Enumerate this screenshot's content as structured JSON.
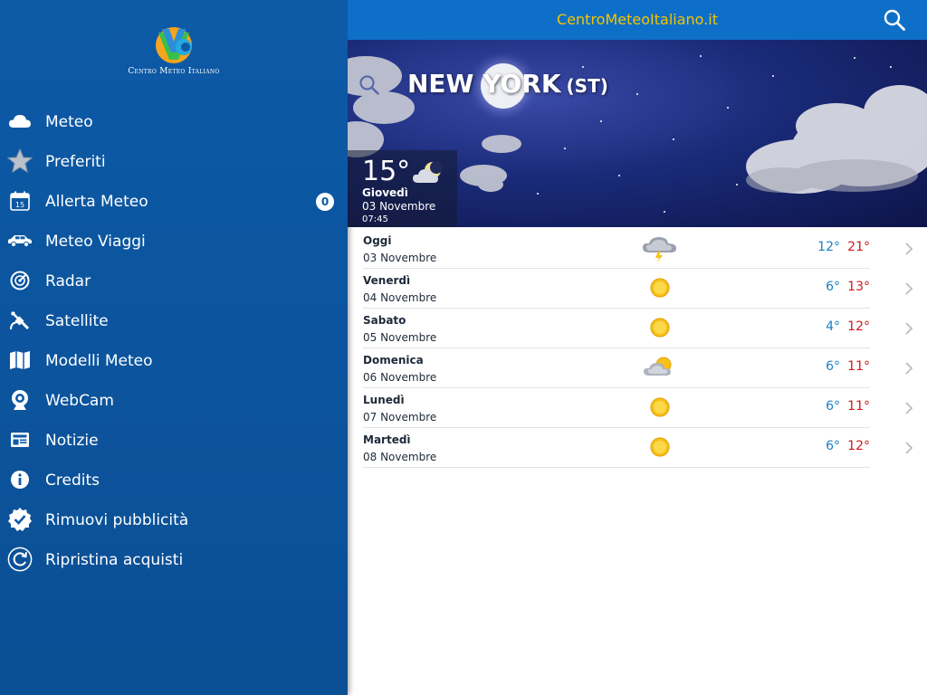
{
  "sidebar": {
    "logo_text": "Centro Meteo Italiano",
    "items": [
      {
        "label": "Meteo",
        "icon": "cloud-icon"
      },
      {
        "label": "Preferiti",
        "icon": "star-icon"
      },
      {
        "label": "Allerta Meteo",
        "icon": "calendar-icon",
        "badge": "0"
      },
      {
        "label": "Meteo Viaggi",
        "icon": "car-icon"
      },
      {
        "label": "Radar",
        "icon": "radar-icon"
      },
      {
        "label": "Satellite",
        "icon": "satellite-icon"
      },
      {
        "label": "Modelli Meteo",
        "icon": "map-icon"
      },
      {
        "label": "WebCam",
        "icon": "webcam-icon"
      },
      {
        "label": "Notizie",
        "icon": "news-icon"
      },
      {
        "label": "Credits",
        "icon": "info-icon"
      },
      {
        "label": "Rimuovi pubblicità",
        "icon": "verified-badge-icon"
      },
      {
        "label": "Ripristina acquisti",
        "icon": "restore-icon"
      }
    ]
  },
  "header": {
    "site_title": "CentroMeteoItaliano.it"
  },
  "hero": {
    "city": "NEW YORK",
    "city_suffix": "(ST)",
    "current": {
      "temp": "15°",
      "day": "Giovedì",
      "date": "03 Novembre",
      "time": "07:45",
      "icon": "moon-cloud-icon"
    }
  },
  "forecast": [
    {
      "day": "Oggi",
      "date": "03 Novembre",
      "min": "12°",
      "max": "21°",
      "icon": "storm-cloud-icon"
    },
    {
      "day": "Venerdì",
      "date": "04 Novembre",
      "min": "6°",
      "max": "13°",
      "icon": "sun-icon"
    },
    {
      "day": "Sabato",
      "date": "05 Novembre",
      "min": "4°",
      "max": "12°",
      "icon": "sun-icon"
    },
    {
      "day": "Domenica",
      "date": "06 Novembre",
      "min": "6°",
      "max": "11°",
      "icon": "sun-cloud-icon"
    },
    {
      "day": "Lunedì",
      "date": "07 Novembre",
      "min": "6°",
      "max": "11°",
      "icon": "sun-icon"
    },
    {
      "day": "Martedì",
      "date": "08 Novembre",
      "min": "6°",
      "max": "12°",
      "icon": "sun-icon"
    }
  ],
  "colors": {
    "sidebar_bg": "#0d5aa7",
    "topbar_bg": "#0e6fc8",
    "title_yellow": "#f5c400",
    "min_temp_blue": "#1a7fc2",
    "max_temp_red": "#cc1a1a"
  }
}
